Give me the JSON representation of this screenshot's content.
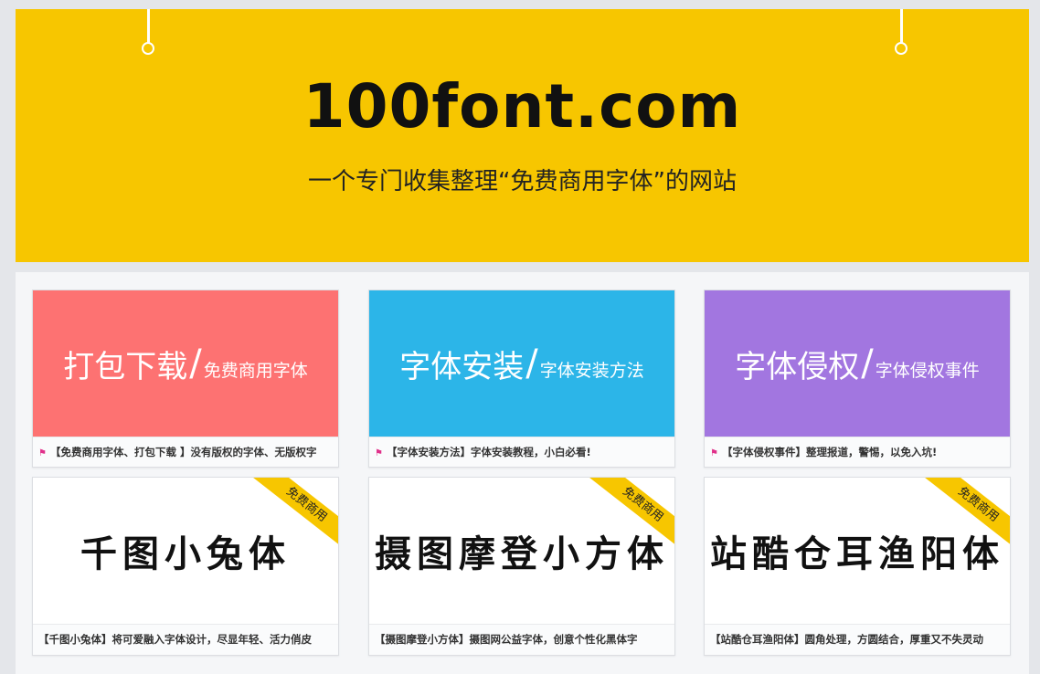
{
  "banner": {
    "title": "100font.com",
    "subtitle": "一个专门收集整理“免费商用字体”的网站"
  },
  "top_cards": [
    {
      "big": "打包下载",
      "sep": "/",
      "small": "免费商用字体",
      "color": "#fd7272",
      "caption": "【免费商用字体、打包下载 】没有版权的字体、无版权字"
    },
    {
      "big": "字体安装",
      "sep": "/",
      "small": "字体安装方法",
      "color": "#2cb5e8",
      "caption": "【字体安装方法】字体安装教程，小白必看!"
    },
    {
      "big": "字体侵权",
      "sep": "/",
      "small": "字体侵权事件",
      "color": "#a276e0",
      "caption": "【字体侵权事件】整理报道，警惕，以免入坑!"
    }
  ],
  "font_cards": [
    {
      "preview": "千图小兔体",
      "badge": "免费商用",
      "caption": "【千图小兔体】将可爱融入字体设计，尽显年轻、活力俏皮"
    },
    {
      "preview": "摄图摩登小方体",
      "badge": "免费商用",
      "caption": "【摄图摩登小方体】摄图网公益字体，创意个性化黑体字"
    },
    {
      "preview": "站酷仓耳渔阳体",
      "badge": "免费商用",
      "caption": "【站酷仓耳渔阳体】圆角处理，方圆结合，厚重又不失灵动"
    }
  ],
  "accent_color": "#f7c600",
  "flag_icon": "flag-icon"
}
